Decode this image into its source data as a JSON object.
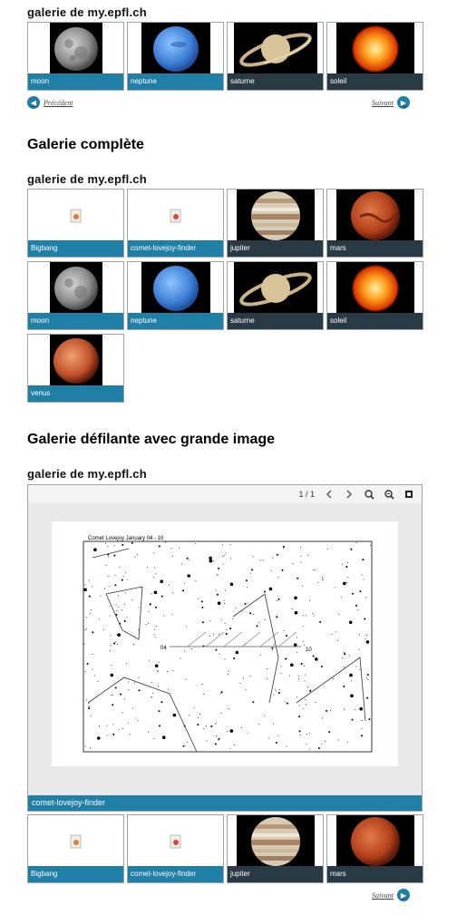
{
  "gallery1": {
    "heading": "galerie de my.epfl.ch",
    "items": [
      {
        "label": "moon"
      },
      {
        "label": "neptune"
      },
      {
        "label": "saturne"
      },
      {
        "label": "soleil"
      }
    ],
    "prev_label": "Précédent",
    "next_label": "Suivant"
  },
  "section2": {
    "title": "Galerie complète",
    "heading": "galerie de my.epfl.ch",
    "items": [
      {
        "label": "Bigbang"
      },
      {
        "label": "comet-lovejoy-finder"
      },
      {
        "label": "jupiter"
      },
      {
        "label": "mars"
      },
      {
        "label": "moon"
      },
      {
        "label": "neptune"
      },
      {
        "label": "saturne"
      },
      {
        "label": "soleil"
      },
      {
        "label": "venus"
      }
    ]
  },
  "section3": {
    "title": "Galerie défilante avec grande image",
    "heading": "galerie de my.epfl.ch",
    "counter": "1 / 1",
    "chart_caption": "Comet Lovejoy January 04 - 10",
    "marker_start": "04",
    "marker_end": "10",
    "viewer_caption": "comet-lovejoy-finder",
    "items": [
      {
        "label": "Bigbang"
      },
      {
        "label": "comet-lovejoy-finder"
      },
      {
        "label": "jupiter"
      },
      {
        "label": "mars"
      }
    ],
    "next_label": "Suivant"
  }
}
